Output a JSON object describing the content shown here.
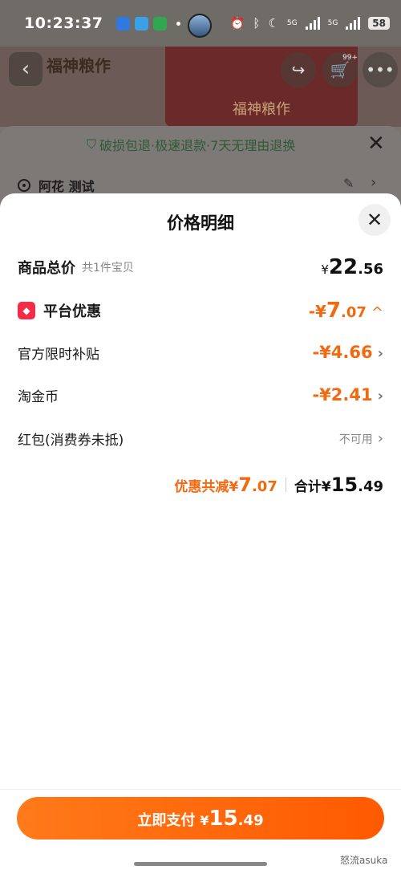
{
  "status_bar": {
    "time": "10:23:37",
    "network_1": "5G",
    "network_2": "5G",
    "battery": "58"
  },
  "background": {
    "shop_name": "福神粮作",
    "banner_text": "福神粮作",
    "cart_badge": "99+",
    "guarantee": "破损包退·极速退款·7天无理由退换",
    "address": "阿花 测试"
  },
  "sheet": {
    "title": "价格明细",
    "subtotal": {
      "label": "商品总价",
      "sub": "共1件宝贝",
      "symbol": "¥",
      "int": "22",
      "dec": ".56"
    },
    "platform_discount": {
      "label": "平台优惠",
      "prefix": "-¥",
      "int": "7",
      "dec": ".07",
      "chevron": "^"
    },
    "items": [
      {
        "label": "官方限时补贴",
        "value": "-¥4.66"
      },
      {
        "label": "淘金币",
        "value": "-¥2.41"
      },
      {
        "label": "红包(消费券未抵)",
        "value": "不可用"
      }
    ],
    "summary": {
      "discount_label": "优惠共减¥",
      "discount_int": "7",
      "discount_dec": ".07",
      "total_label": "合计¥",
      "total_int": "15",
      "total_dec": ".49"
    }
  },
  "footer": {
    "pay_label": "立即支付",
    "pay_symbol": "¥",
    "pay_int": "15",
    "pay_dec": ".49",
    "watermark": "怒流asuka"
  },
  "colors": {
    "accent": "#f26a10",
    "pay_button": "#ff6a0a",
    "promo_badge": "#f52c48"
  }
}
